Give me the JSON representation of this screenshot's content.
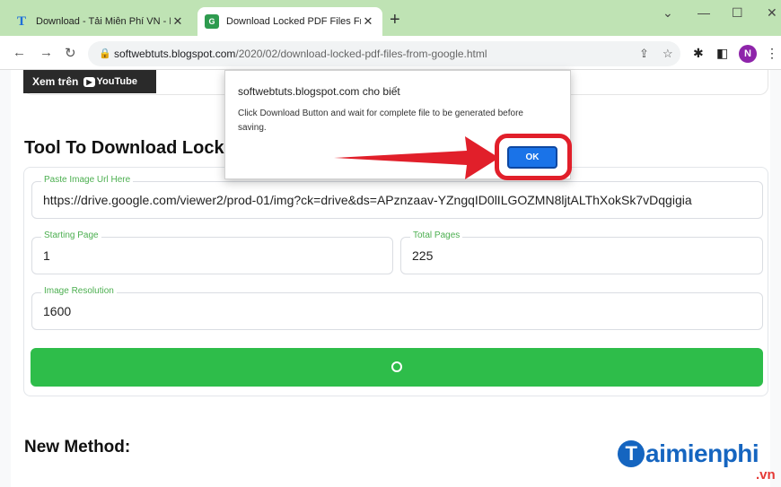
{
  "browser": {
    "tabs": [
      {
        "title": "Download - Tải Miễn Phí VN - Ph",
        "favicon": "T"
      },
      {
        "title": "Download Locked PDF Files From",
        "favicon": "G"
      }
    ],
    "url_domain": "softwebtuts.blogspot.com",
    "url_path": "/2020/02/download-locked-pdf-files-from-google.html",
    "profile_initial": "N",
    "new_tab": "+",
    "close_tab": "✕",
    "controls": {
      "chevron": "⌄",
      "minimize": "—",
      "maximize": "☐",
      "close": "✕"
    }
  },
  "page": {
    "youtube_button": {
      "label": "Xem trên",
      "logo": "▶",
      "brand": "YouTube"
    },
    "heading": "Tool To Download Lock",
    "fields": {
      "image_url": {
        "label": "Paste Image Url Here",
        "value": "https://drive.google.com/viewer2/prod-01/img?ck=drive&ds=APznzaav-YZngqID0lILGOZMN8ljtALThXokSk7vDqgigia"
      },
      "starting_page": {
        "label": "Starting Page",
        "value": "1"
      },
      "total_pages": {
        "label": "Total Pages",
        "value": "225"
      },
      "resolution": {
        "label": "Image Resolution",
        "value": "1600"
      }
    },
    "new_method_heading": "New Method:"
  },
  "dialog": {
    "origin": "softwebtuts.blogspot.com cho biết",
    "message": "Click Download Button and wait for complete file to be generated before saving.",
    "ok_label": "OK"
  },
  "watermark": {
    "letter": "T",
    "text": "aimienphi",
    "suffix": ".vn"
  },
  "colors": {
    "accent_green": "#2ebd4a",
    "highlight_red": "#e11f2a",
    "dialog_button": "#1a73e8",
    "tabstrip": "#bfe3b4"
  }
}
